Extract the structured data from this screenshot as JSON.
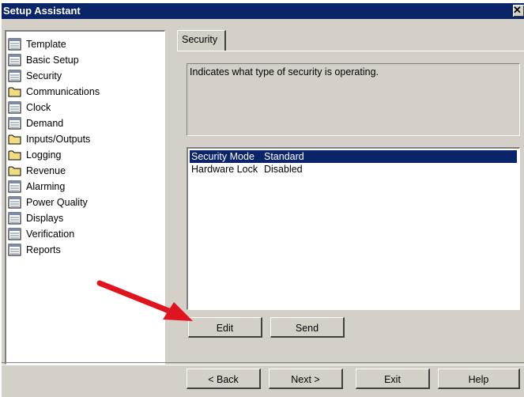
{
  "window": {
    "title": "Setup Assistant",
    "close_glyph": "✕"
  },
  "tree": {
    "items": [
      {
        "label": "Template",
        "icon": "sheet"
      },
      {
        "label": "Basic Setup",
        "icon": "sheet"
      },
      {
        "label": "Security",
        "icon": "folder",
        "selected": true
      },
      {
        "label": "Communications",
        "icon": "folder"
      },
      {
        "label": "Clock",
        "icon": "sheet"
      },
      {
        "label": "Demand",
        "icon": "sheet"
      },
      {
        "label": "Inputs/Outputs",
        "icon": "folder"
      },
      {
        "label": "Logging",
        "icon": "folder"
      },
      {
        "label": "Revenue",
        "icon": "folder"
      },
      {
        "label": "Alarming",
        "icon": "sheet"
      },
      {
        "label": "Power Quality",
        "icon": "sheet"
      },
      {
        "label": "Displays",
        "icon": "sheet"
      },
      {
        "label": "Verification",
        "icon": "sheet"
      },
      {
        "label": "Reports",
        "icon": "sheet"
      }
    ]
  },
  "tab": {
    "label": "Security"
  },
  "description": "Indicates what type of security is operating.",
  "settings": {
    "rows": [
      {
        "name": "Security Mode",
        "value": "Standard",
        "selected": true
      },
      {
        "name": "Hardware Lock",
        "value": "Disabled"
      }
    ]
  },
  "actions": {
    "edit": "Edit",
    "send": "Send"
  },
  "footer": {
    "back": "< Back",
    "next": "Next >",
    "exit": "Exit",
    "help": "Help"
  },
  "colors": {
    "titlebar": "#0a246a",
    "arrow": "#e0141e",
    "face": "#d4d0c8"
  }
}
